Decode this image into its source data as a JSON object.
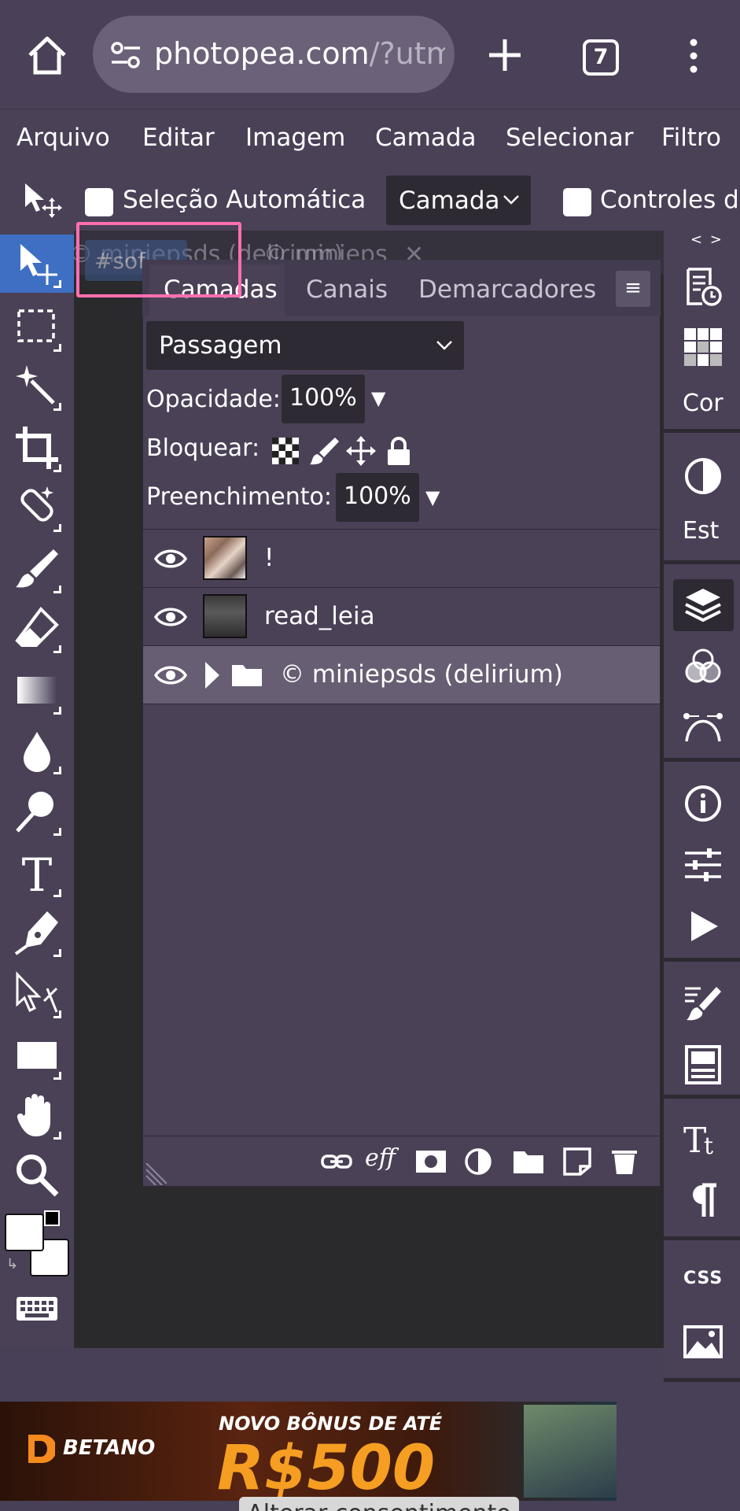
{
  "browser": {
    "url_main": "photopea.com",
    "url_rest": "/?utm_",
    "tab_count": "7"
  },
  "menu": {
    "items": [
      "Arquivo",
      "Editar",
      "Imagem",
      "Camada",
      "Selecionar",
      "Filtro"
    ]
  },
  "options": {
    "auto_select_label": "Seleção Automática",
    "select_target": "Camada",
    "controls_label": "Controles de"
  },
  "doc_tabs": {
    "tab1": "© miniepsds (delirium)",
    "tab2": "© minieps",
    "tag": "#sof"
  },
  "layers_panel": {
    "tabs": [
      "Camadas",
      "Canais",
      "Demarcadores"
    ],
    "menu_glyph": "≡",
    "blend_mode": "Passagem",
    "opacity_label": "Opacidade:",
    "opacity_value": "100%",
    "lock_label": "Bloquear:",
    "fill_label": "Preenchimento:",
    "fill_value": "100%",
    "layers": [
      {
        "name": "!",
        "type": "image"
      },
      {
        "name": "read_leia",
        "type": "image"
      },
      {
        "name": "© miniepsds (delirium)",
        "type": "group",
        "selected": true
      }
    ],
    "bottom_eff": "eff"
  },
  "right_panel": {
    "toggle": "< >",
    "cor_label": "Cor",
    "est_label": "Est",
    "css_label": "CSS"
  },
  "ad": {
    "brand": "BETANO",
    "headline": "NOVO BÔNUS DE ATÉ",
    "amount": "R$500"
  },
  "consent_label": "Alterar consentimento",
  "colors": {
    "ui_bg": "#4a4157",
    "canvas": "#2a2a2c",
    "active_tool": "#3e6fc3",
    "highlight": "#ff6fb0",
    "selected_row": "#675e73"
  }
}
